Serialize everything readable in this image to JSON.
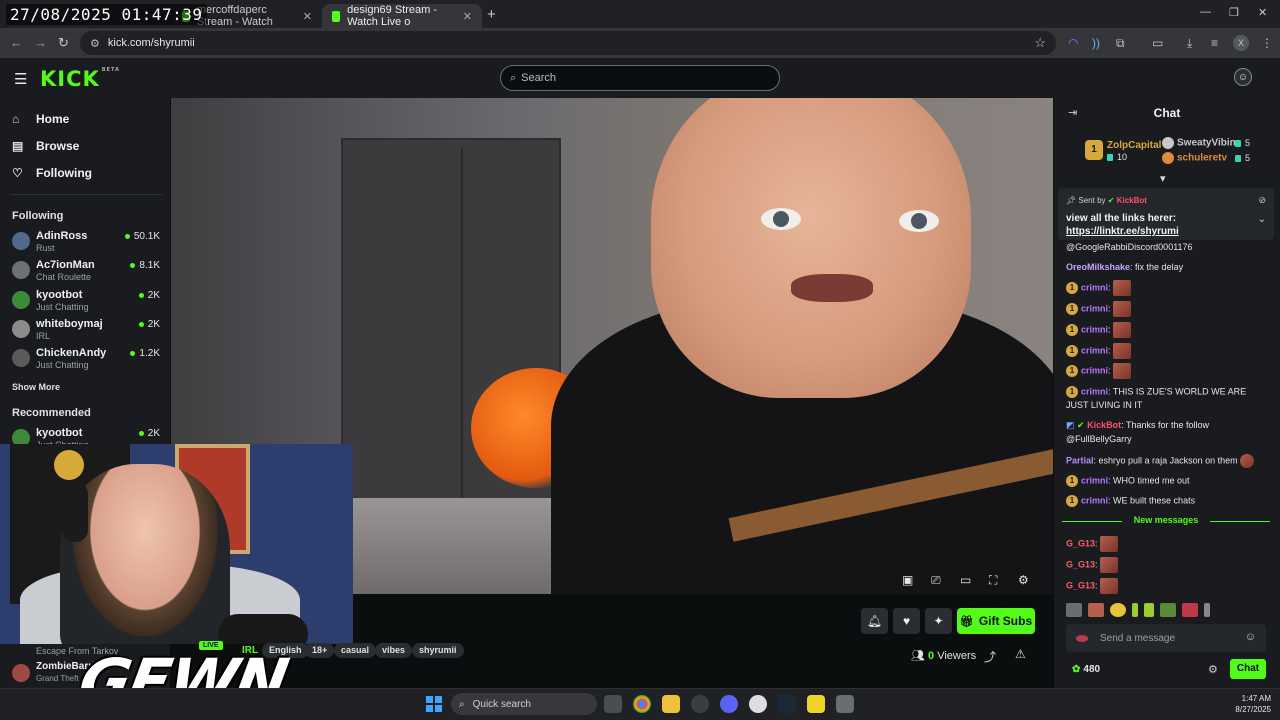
{
  "overlay": {
    "timestamp": "27/08/2025 01:47:39"
  },
  "browser": {
    "tabs": [
      {
        "label": "mercoffdaperc Stream - Watch",
        "favicon_color": "#53fc18"
      },
      {
        "label": "design69 Stream - Watch Live o",
        "favicon_color": "#53fc18"
      }
    ],
    "url": "kick.com/shyrumii",
    "profile_initial": "X"
  },
  "header": {
    "logo": "KICK",
    "logo_badge": "BETA",
    "search_placeholder": "Search"
  },
  "sidebar": {
    "nav": [
      {
        "label": "Home",
        "icon": "home-icon"
      },
      {
        "label": "Browse",
        "icon": "browse-icon"
      },
      {
        "label": "Following",
        "icon": "heart-icon"
      }
    ],
    "following_title": "Following",
    "following": [
      {
        "name": "AdinRoss",
        "category": "Rust",
        "viewers": "50.1K",
        "avatar_color": "#4f6a8a"
      },
      {
        "name": "Ac7ionMan",
        "category": "Chat Roulette",
        "viewers": "8.1K",
        "avatar_color": "#6d7075"
      },
      {
        "name": "kyootbot",
        "category": "Just Chatting",
        "viewers": "2K",
        "avatar_color": "#3d8a3a"
      },
      {
        "name": "whiteboymaj",
        "category": "IRL",
        "viewers": "2K",
        "avatar_color": "#8c8c8c"
      },
      {
        "name": "ChickenAndy",
        "category": "Just Chatting",
        "viewers": "1.2K",
        "avatar_color": "#5a5a5a"
      }
    ],
    "show_more": "Show More",
    "recommended_title": "Recommended",
    "recommended": [
      {
        "name": "kyootbot",
        "category": "Just Chatting",
        "viewers": "2K",
        "avatar_color": "#3d8a3a"
      }
    ]
  },
  "stream": {
    "bottom_channel": {
      "name": "ZombieBarrier",
      "category": "Grand Theft",
      "avatar_color": "#a04848"
    },
    "category_line": "Escape From Tarkov",
    "live_label": "LIVE",
    "watermark": "GEWN",
    "irl_label": "IRL",
    "tags": [
      "English",
      "18+",
      "casual",
      "vibes",
      "shyrumii"
    ],
    "gift_subs_label": "Gift Subs",
    "viewers_count": "0",
    "viewers_label": "Viewers"
  },
  "chat": {
    "title": "Chat",
    "top_gifters": [
      {
        "rank": "1",
        "name": "ZolpCapital",
        "count": "10",
        "color": "#d6a93a"
      },
      {
        "name": "SweatyVibin",
        "count": "5",
        "color": "#c8c8c8"
      },
      {
        "name": "schuleretv",
        "count": "5",
        "color": "#e08a3a"
      }
    ],
    "pinned": {
      "sent_by_label": "Sent by",
      "sender": "KickBot",
      "message": "view all the links herer:",
      "link": "https://linktr.ee/shyrumi"
    },
    "messages": [
      {
        "user": "",
        "text": "@GoogleRabbiDiscord0001176",
        "color": "#e6e6e6"
      },
      {
        "user": "OreoMilkshake",
        "text": "fix the delay",
        "color": "#c9a4ff"
      },
      {
        "user": "crimni",
        "text": "",
        "color": "#b476ff",
        "emote": true
      },
      {
        "user": "crimni",
        "text": "",
        "color": "#b476ff",
        "emote": true
      },
      {
        "user": "crimni",
        "text": "",
        "color": "#b476ff",
        "emote": true
      },
      {
        "user": "crimni",
        "text": "",
        "color": "#b476ff",
        "emote": true
      },
      {
        "user": "crimni",
        "text": "",
        "color": "#b476ff",
        "emote": true
      },
      {
        "user": "crimni",
        "text": "THIS IS ZUE'S WORLD WE ARE",
        "color": "#b476ff"
      },
      {
        "user": "",
        "text": "JUST LIVING IN IT",
        "color": "#e6e6e6"
      },
      {
        "user": "KickBot",
        "text": "Thanks for the follow",
        "color": "#ff4f6d"
      },
      {
        "user": "",
        "text": "@FullBellyGarry",
        "color": "#e6e6e6"
      },
      {
        "user": "Partial",
        "text": "eshryo pull a raja Jackson on them",
        "color": "#b98cff"
      },
      {
        "user": "crimni",
        "text": "WHO timed me out",
        "color": "#b476ff"
      },
      {
        "user": "crimni",
        "text": "WE built these chats",
        "color": "#b476ff"
      }
    ],
    "new_messages_label": "New messages",
    "new_messages": [
      {
        "user": "G_G13",
        "color": "#ff5a6a"
      },
      {
        "user": "G_G13",
        "color": "#ff5a6a"
      },
      {
        "user": "G_G13",
        "color": "#ff5a6a"
      }
    ],
    "input_placeholder": "Send a message",
    "points": "480",
    "send_label": "Chat"
  },
  "taskbar": {
    "search_label": "Quick search",
    "time": "1:47 AM",
    "date": "8/27/2025"
  },
  "colors": {
    "brand": "#53fc18",
    "chat_bg": "#191b1f",
    "page_bg": "#0b0e0f"
  }
}
